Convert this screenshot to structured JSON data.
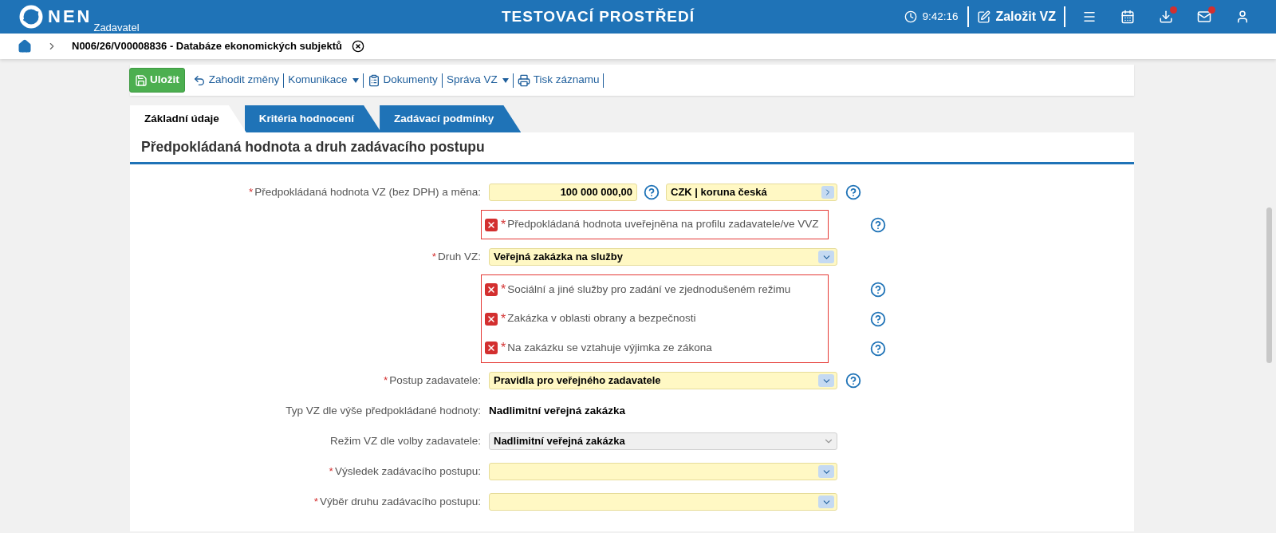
{
  "header": {
    "logo_text": "NEN",
    "logo_sub": "Zadavatel",
    "title": "TESTOVACÍ PROSTŘEDÍ",
    "time": "9:42:16",
    "create_label": "Založit VZ",
    "icons": [
      {
        "kind": "menu",
        "badge": false
      },
      {
        "kind": "calendar",
        "badge": false
      },
      {
        "kind": "download",
        "badge": true
      },
      {
        "kind": "mail",
        "badge": true
      },
      {
        "kind": "user",
        "badge": false
      }
    ]
  },
  "breadcrumb": {
    "text": "N006/26/V00008836 - Databáze ekonomických subjektů"
  },
  "toolbar": [
    {
      "kind": "save",
      "label": "Uložit"
    },
    {
      "kind": "discard",
      "label": "Zahodit změny"
    },
    {
      "kind": "menu",
      "label": "Komunikace"
    },
    {
      "kind": "documents",
      "label": "Dokumenty"
    },
    {
      "kind": "menu",
      "label": "Správa VZ"
    },
    {
      "kind": "print",
      "label": "Tisk záznamu"
    }
  ],
  "tabs": [
    {
      "label": "Základní údaje",
      "selected": true
    },
    {
      "label": "Kritéria hodnocení",
      "selected": false
    },
    {
      "label": "Zadávací podmínky",
      "selected": false
    }
  ],
  "section": {
    "title": "Předpokládaná hodnota a druh zadávacího postupu",
    "rows": [
      {
        "kind": "amount",
        "required_mark": "*",
        "label": "Předpokládaná hodnota VZ (bez DPH) a měna:",
        "value": "100 000 000,00",
        "currency": "CZK | koruna česká",
        "help": true
      },
      {
        "kind": "checks",
        "error": true,
        "items": [
          {
            "required_mark": "*",
            "label": "Předpokládaná hodnota uveřejněna na profilu zadavatele/ve VVZ",
            "help": true
          }
        ]
      },
      {
        "kind": "select",
        "required_mark": "*",
        "label": "Druh VZ:",
        "value": "Veřejná zakázka na služby",
        "disabled": false,
        "help": false
      },
      {
        "kind": "checks",
        "error": true,
        "items": [
          {
            "required_mark": "*",
            "label": "Sociální a jiné služby pro zadání ve zjednodušeném režimu",
            "help": true
          },
          {
            "required_mark": "*",
            "label": "Zakázka v oblasti obrany a bezpečnosti",
            "help": true
          },
          {
            "required_mark": "*",
            "label": "Na zakázku se vztahuje výjimka ze zákona",
            "help": true
          }
        ]
      },
      {
        "kind": "select",
        "required_mark": "*",
        "label": "Postup zadavatele:",
        "value": "Pravidla pro veřejného zadavatele",
        "disabled": false,
        "help": true
      },
      {
        "kind": "static",
        "label": "Typ VZ dle výše předpokládané hodnoty:",
        "value": "Nadlimitní veřejná zakázka"
      },
      {
        "kind": "select",
        "label": "Režim VZ dle volby zadavatele:",
        "value": "Nadlimitní veřejná zakázka",
        "disabled": true,
        "help": false
      },
      {
        "kind": "select",
        "required_mark": "*",
        "label": "Výsledek zadávacího postupu:",
        "disabled": false,
        "help": false
      },
      {
        "kind": "select",
        "required_mark": "*",
        "label": "Výběr druhu zadávacího postupu:",
        "disabled": false,
        "help": false
      }
    ]
  }
}
